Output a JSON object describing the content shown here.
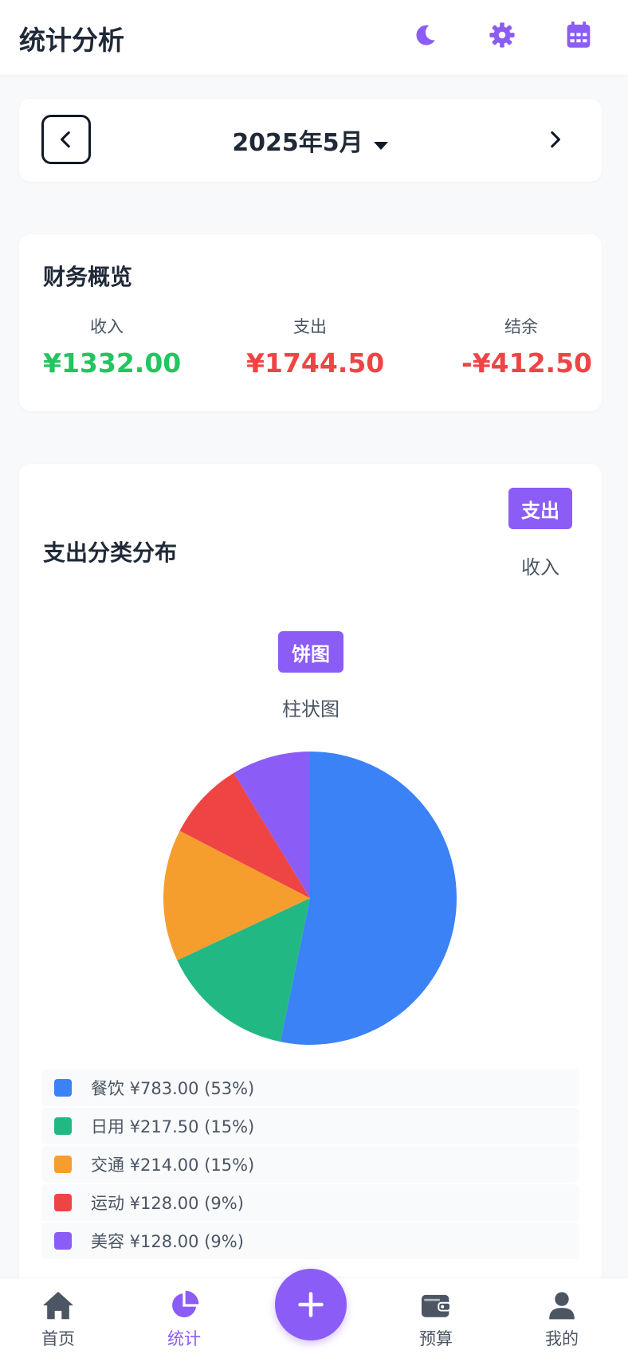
{
  "header": {
    "title": "统计分析"
  },
  "month": {
    "label": "2025年5月"
  },
  "overview": {
    "title": "财务概览",
    "income_label": "收入",
    "income_value": "¥1332.00",
    "expense_label": "支出",
    "expense_value": "¥1744.50",
    "balance_label": "结余",
    "balance_value": "-¥412.50"
  },
  "distribution": {
    "title": "支出分类分布",
    "type_active": "支出",
    "type_inactive": "收入",
    "chart_active": "饼图",
    "chart_inactive": "柱状图"
  },
  "chart_data": {
    "type": "pie",
    "categories": [
      "餐饮",
      "日用",
      "交通",
      "运动",
      "美容"
    ],
    "values": [
      783.0,
      217.5,
      214.0,
      128.0,
      128.0
    ],
    "percents": [
      53,
      15,
      15,
      9,
      9
    ],
    "colors": [
      "#3b82f6",
      "#22b883",
      "#f59e2e",
      "#ef4444",
      "#8b5cf6"
    ],
    "legend": [
      "餐饮 ¥783.00 (53%)",
      "日用 ¥217.50 (15%)",
      "交通 ¥214.00 (15%)",
      "运动 ¥128.00 (9%)",
      "美容 ¥128.00 (9%)"
    ]
  },
  "nav": {
    "home": "首页",
    "stats": "统计",
    "budget": "预算",
    "me": "我的"
  },
  "colors": {
    "accent": "#8b5cf6",
    "income": "#22c55e",
    "expense": "#ef4444"
  }
}
